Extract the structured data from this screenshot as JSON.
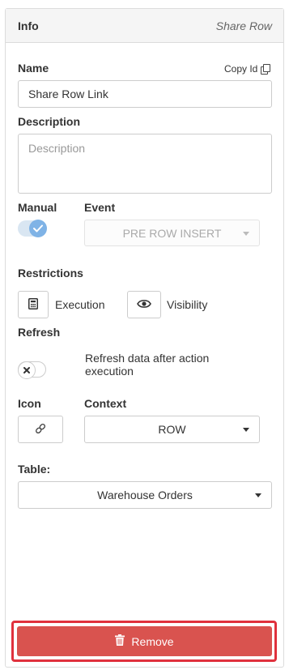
{
  "header": {
    "title": "Info",
    "subtitle": "Share Row"
  },
  "name": {
    "label": "Name",
    "copy_label": "Copy Id",
    "value": "Share Row Link"
  },
  "description": {
    "label": "Description",
    "placeholder": "Description"
  },
  "manual": {
    "label": "Manual",
    "checked": true
  },
  "event": {
    "label": "Event",
    "value": "PRE ROW INSERT",
    "disabled": true
  },
  "restrictions": {
    "label": "Restrictions",
    "execution_label": "Execution",
    "execution_icon": "calculator-icon",
    "visibility_label": "Visibility",
    "visibility_icon": "eye-icon"
  },
  "refresh": {
    "label": "Refresh",
    "checked": false,
    "description": "Refresh data after action execution"
  },
  "icon": {
    "label": "Icon",
    "value": "link-icon"
  },
  "context": {
    "label": "Context",
    "value": "ROW"
  },
  "table": {
    "label": "Table:",
    "value": "Warehouse Orders"
  },
  "remove": {
    "label": "Remove",
    "icon": "trash-icon",
    "color": "#d9534f",
    "highlight": "#e0313d"
  },
  "colors": {
    "toggle_on": "#7fb3e6",
    "header_bg": "#f5f5f5"
  }
}
